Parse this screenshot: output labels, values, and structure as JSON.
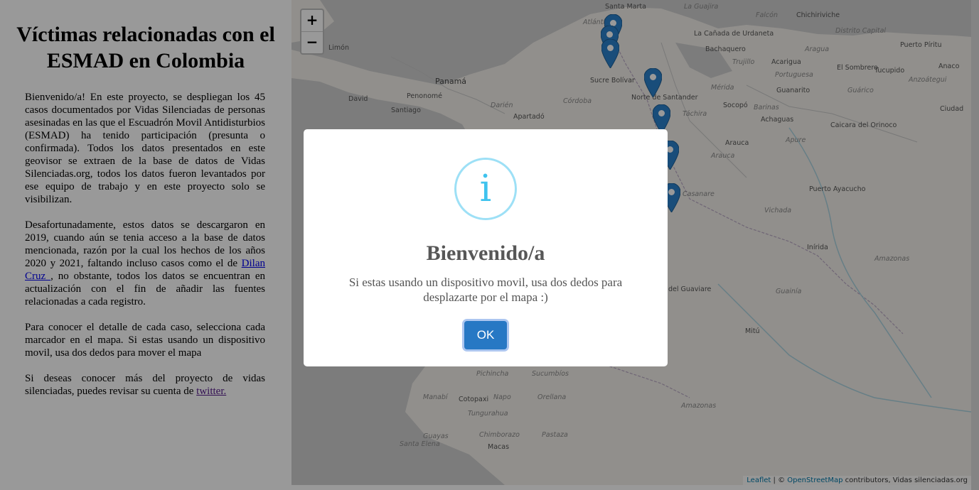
{
  "sidebar": {
    "title": "Víctimas relacionadas con el ESMAD en Colombia",
    "p1": "Bienvenido/a! En este proyecto, se despliegan los 45 casos documentados por Vidas Silenciadas de personas asesinadas en las que el Escuadrón Movil Antidisturbios (ESMAD) ha tenido participación (presunta o confirmada). Todos los datos presentados en este geovisor se extraen de la base de datos de Vidas Silenciadas.org, todos los datos fueron levantados por ese equipo de trabajo y en este proyecto solo se visibilizan.",
    "p2_before": "Desafortunadamente, estos datos se descargaron en 2019, cuando aún se tenia acceso a la base de datos mencionada, razón por la cual los hechos de los años 2020 y 2021, faltando incluso casos como el de ",
    "p2_link": "Dilan Cruz ",
    "p2_after": ", no obstante, todos los datos se encuentran en actualización con el fin de añadir las fuentes relacionadas a cada registro.",
    "p3": "Para conocer el detalle de cada caso, selecciona cada marcador en el mapa. Si estas usando un dispositivo movil, usa dos dedos para mover el mapa",
    "p4_before": "Si deseas conocer más del proyecto de vidas silenciadas, puedes revisar su cuenta de ",
    "p4_link": "twitter."
  },
  "map": {
    "zoom_in": "+",
    "zoom_out": "−",
    "attribution_leaflet": "Leaflet",
    "attribution_sep": " | © ",
    "attribution_osm": "OpenStreetMap",
    "attribution_rest": " contributors, Vidas silenciadas.org",
    "marker_color": "#2a81cb",
    "labels": [
      "Santa Marta",
      "La Guajira",
      "Falcón",
      "Chichiriviche",
      "Atlántico",
      "La Cañada de Urdaneta",
      "Distrito Capital",
      "Limón",
      "Bachaquero",
      "Trujillo",
      "Aragua",
      "Puerto Píritu",
      "Panamá",
      "Acarigua",
      "El Sombrero",
      "Tucupido",
      "Anaco",
      "Sucre Bolívar",
      "Portuguesa",
      "Anzoátegui",
      "Mérida",
      "Guanarito",
      "Guárico",
      "David",
      "Penonomé",
      "Norte de Santander",
      "Socopó",
      "Barinas",
      "Ciudad",
      "Santiago",
      "Darién",
      "Córdoba",
      "Apartadó",
      "Táchira",
      "Achaguas",
      "Caicara del Orinoco",
      "Arauca",
      "Apure",
      "Arauca",
      "Casanare",
      "Puerto Ayacucho",
      "Vichada",
      "Inírida",
      "Amazonas",
      "del Guaviare",
      "Guainía",
      "Mitú",
      "Pichincha",
      "Sucumbíos",
      "Manabí",
      "Cotopaxi",
      "Napo",
      "Orellana",
      "Tungurahua",
      "Guayas",
      "Chimborazo",
      "Pastaza",
      "Santa Elena",
      "Macas",
      "Amazonas"
    ]
  },
  "modal": {
    "icon": "i",
    "title": "Bienvenido/a",
    "message": "Si estas usando un dispositivo movil, usa dos dedos para desplazarte por el mapa :)",
    "ok_label": "OK"
  }
}
